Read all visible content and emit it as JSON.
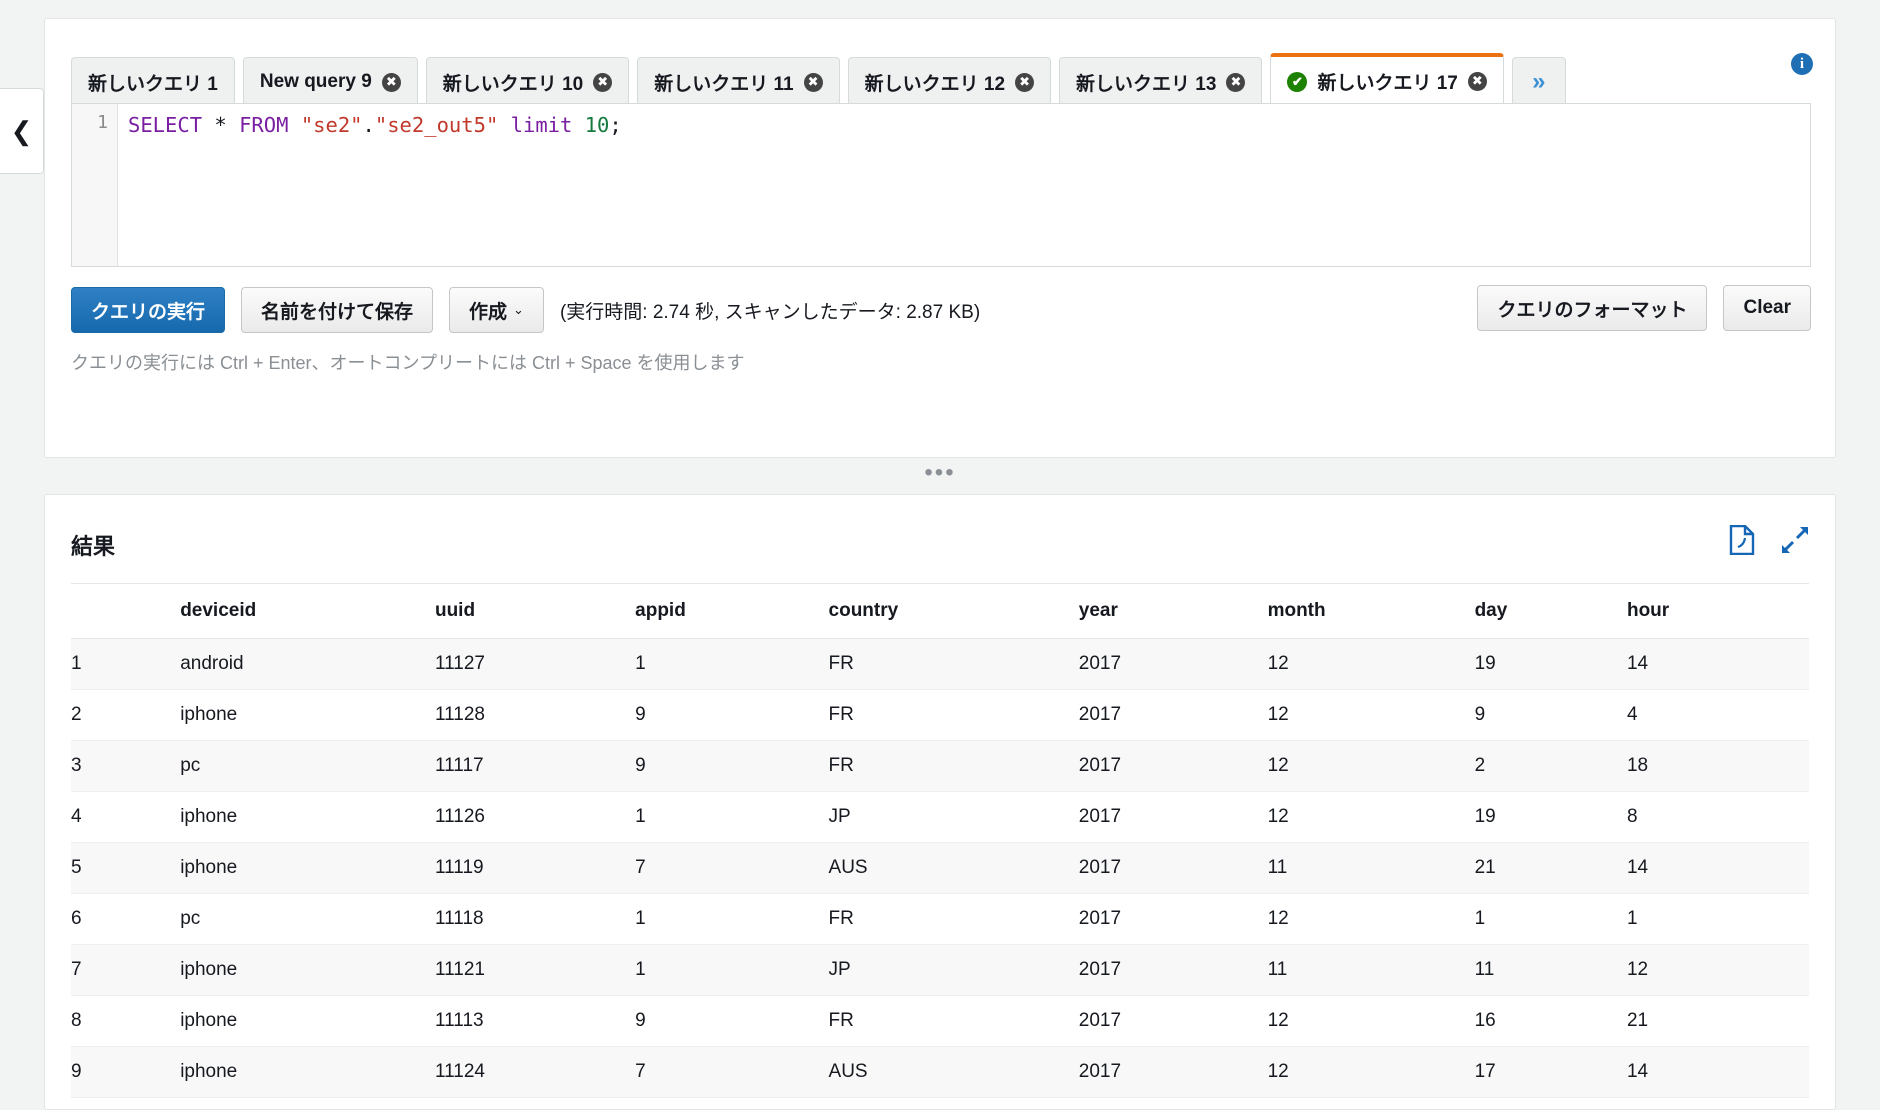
{
  "left_rail": {
    "collapse_icon": "chevron-left-icon"
  },
  "info_icon": {
    "glyph": "i",
    "name": "info-icon"
  },
  "tabs": {
    "items": [
      {
        "label": "新しいクエリ 1",
        "closable": false,
        "active": false,
        "status": null
      },
      {
        "label": "New query 9",
        "closable": true,
        "active": false,
        "status": null
      },
      {
        "label": "新しいクエリ 10",
        "closable": true,
        "active": false,
        "status": null
      },
      {
        "label": "新しいクエリ 11",
        "closable": true,
        "active": false,
        "status": null
      },
      {
        "label": "新しいクエリ 12",
        "closable": true,
        "active": false,
        "status": null
      },
      {
        "label": "新しいクエリ 13",
        "closable": true,
        "active": false,
        "status": null
      },
      {
        "label": "新しいクエリ 17",
        "closable": true,
        "active": true,
        "status": "success-check-icon"
      }
    ],
    "more_label": "»",
    "close_glyph": "✖",
    "check_glyph": "✔",
    "active_accent": "#ec7211"
  },
  "editor": {
    "line_number": "1",
    "sql_tokens": [
      {
        "t": "SELECT",
        "c": "kw"
      },
      {
        "t": " ",
        "c": "pn"
      },
      {
        "t": "*",
        "c": "op"
      },
      {
        "t": " ",
        "c": "pn"
      },
      {
        "t": "FROM",
        "c": "kw"
      },
      {
        "t": " ",
        "c": "pn"
      },
      {
        "t": "\"se2\"",
        "c": "str"
      },
      {
        "t": ".",
        "c": "pn"
      },
      {
        "t": "\"se2_out5\"",
        "c": "str"
      },
      {
        "t": " ",
        "c": "pn"
      },
      {
        "t": "limit",
        "c": "kw"
      },
      {
        "t": " ",
        "c": "pn"
      },
      {
        "t": "10",
        "c": "num"
      },
      {
        "t": ";",
        "c": "pn"
      }
    ],
    "sql_text": "SELECT * FROM \"se2\".\"se2_out5\" limit 10;"
  },
  "toolbar": {
    "run_label": "クエリの実行",
    "save_as_label": "名前を付けて保存",
    "create_label": "作成",
    "create_caret": "⌄",
    "stats": "(実行時間: 2.74 秒, スキャンしたデータ: 2.87 KB)",
    "format_label": "クエリのフォーマット",
    "clear_label": "Clear",
    "hint": "クエリの実行には Ctrl + Enter、オートコンプリートには Ctrl + Space を使用します",
    "primary_color": "#1769ad"
  },
  "splitter": {
    "handle": "•••"
  },
  "results": {
    "title": "結果",
    "download_icon": "download-file-icon",
    "expand_icon": "expand-arrows-icon",
    "icon_color": "#1566b5",
    "columns": [
      "",
      "deviceid",
      "uuid",
      "appid",
      "country",
      "year",
      "month",
      "day",
      "hour"
    ],
    "rows": [
      [
        "1",
        "android",
        "11127",
        "1",
        "FR",
        "2017",
        "12",
        "19",
        "14"
      ],
      [
        "2",
        "iphone",
        "11128",
        "9",
        "FR",
        "2017",
        "12",
        "9",
        "4"
      ],
      [
        "3",
        "pc",
        "11117",
        "9",
        "FR",
        "2017",
        "12",
        "2",
        "18"
      ],
      [
        "4",
        "iphone",
        "11126",
        "1",
        "JP",
        "2017",
        "12",
        "19",
        "8"
      ],
      [
        "5",
        "iphone",
        "11119",
        "7",
        "AUS",
        "2017",
        "11",
        "21",
        "14"
      ],
      [
        "6",
        "pc",
        "11118",
        "1",
        "FR",
        "2017",
        "12",
        "1",
        "1"
      ],
      [
        "7",
        "iphone",
        "11121",
        "1",
        "JP",
        "2017",
        "11",
        "11",
        "12"
      ],
      [
        "8",
        "iphone",
        "11113",
        "9",
        "FR",
        "2017",
        "12",
        "16",
        "21"
      ],
      [
        "9",
        "iphone",
        "11124",
        "7",
        "AUS",
        "2017",
        "12",
        "17",
        "14"
      ]
    ]
  }
}
